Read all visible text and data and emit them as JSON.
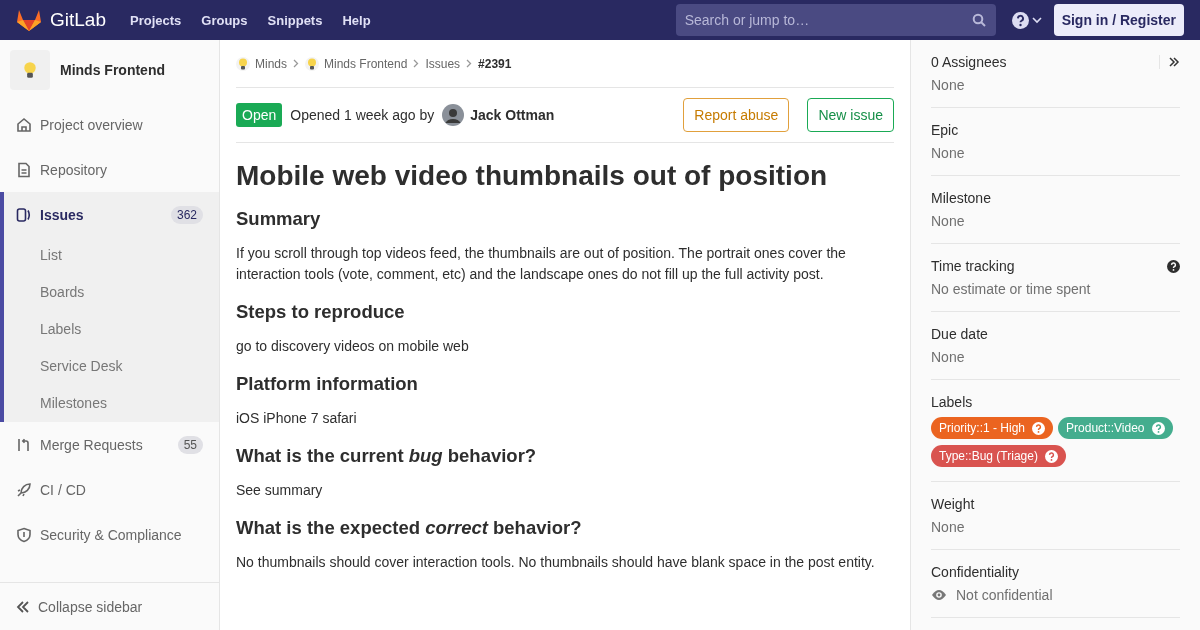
{
  "header": {
    "logo_text": "GitLab",
    "nav": [
      "Projects",
      "Groups",
      "Snippets",
      "Help"
    ],
    "search": {
      "placeholder": "Search or jump to…"
    },
    "sign_in": "Sign in / Register"
  },
  "sidebar": {
    "project": "Minds Frontend",
    "items": [
      {
        "label": "Project overview",
        "selected": false
      },
      {
        "label": "Repository",
        "selected": false
      },
      {
        "label": "Issues",
        "selected": true,
        "count": "362",
        "children": [
          {
            "label": "List",
            "selected": false
          },
          {
            "label": "Boards",
            "selected": false
          },
          {
            "label": "Labels",
            "selected": false
          },
          {
            "label": "Service Desk",
            "selected": false
          },
          {
            "label": "Milestones",
            "selected": false
          }
        ]
      },
      {
        "label": "Merge Requests",
        "selected": false,
        "count": "55"
      },
      {
        "label": "CI / CD",
        "selected": false
      },
      {
        "label": "Security & Compliance",
        "selected": false
      }
    ],
    "collapse": "Collapse sidebar"
  },
  "breadcrumbs": [
    "Minds",
    "Minds Frontend",
    "Issues",
    "#2391"
  ],
  "issue": {
    "status": "Open",
    "opened": "Opened 1 week ago by",
    "author": "Jack Ottman",
    "buttons": [
      "Report abuse",
      "New issue"
    ],
    "title": "Mobile web video thumbnails out of position",
    "body": [
      {
        "kind": "heading",
        "text": "Summary"
      },
      {
        "kind": "paragraph",
        "text": "If you scroll through top videos feed, the thumbnails are out of position. The portrait ones cover the interaction tools (vote, comment, etc) and the landscape ones do not fill up the full activity post."
      },
      {
        "kind": "heading",
        "text": "Steps to reproduce"
      },
      {
        "kind": "paragraph",
        "text": "go to discovery videos on mobile web"
      },
      {
        "kind": "heading",
        "text": "Platform information"
      },
      {
        "kind": "paragraph",
        "text": "iOS iPhone 7 safari"
      },
      {
        "kind": "heading",
        "text": "What is the current *bug* behavior?"
      },
      {
        "kind": "paragraph",
        "text": "See summary"
      },
      {
        "kind": "heading",
        "text": "What is the expected *correct* behavior?"
      },
      {
        "kind": "paragraph",
        "text": "No thumbnails should cover interaction tools. No thumbnails should have blank space in the post entity."
      }
    ]
  },
  "right_sidebar": [
    {
      "kind": "text",
      "title": "0 Assignees",
      "value": "None"
    },
    {
      "kind": "text",
      "title": "Epic",
      "value": "None"
    },
    {
      "kind": "text",
      "title": "Milestone",
      "value": "None"
    },
    {
      "kind": "text",
      "title": "Time tracking",
      "value": "No estimate or time spent",
      "help": true
    },
    {
      "kind": "text",
      "title": "Due date",
      "value": "None"
    },
    {
      "kind": "labels",
      "title": "Labels",
      "labels": [
        {
          "text": "Priority::1 - High",
          "color": "#eb6420"
        },
        {
          "text": "Product::Video",
          "color": "#44ad8e"
        },
        {
          "text": "Type::Bug (Triage)",
          "color": "#d9534f"
        }
      ]
    },
    {
      "kind": "text",
      "title": "Weight",
      "value": "None"
    },
    {
      "kind": "confidential",
      "title": "Confidentiality",
      "value": "Not confidential"
    }
  ]
}
